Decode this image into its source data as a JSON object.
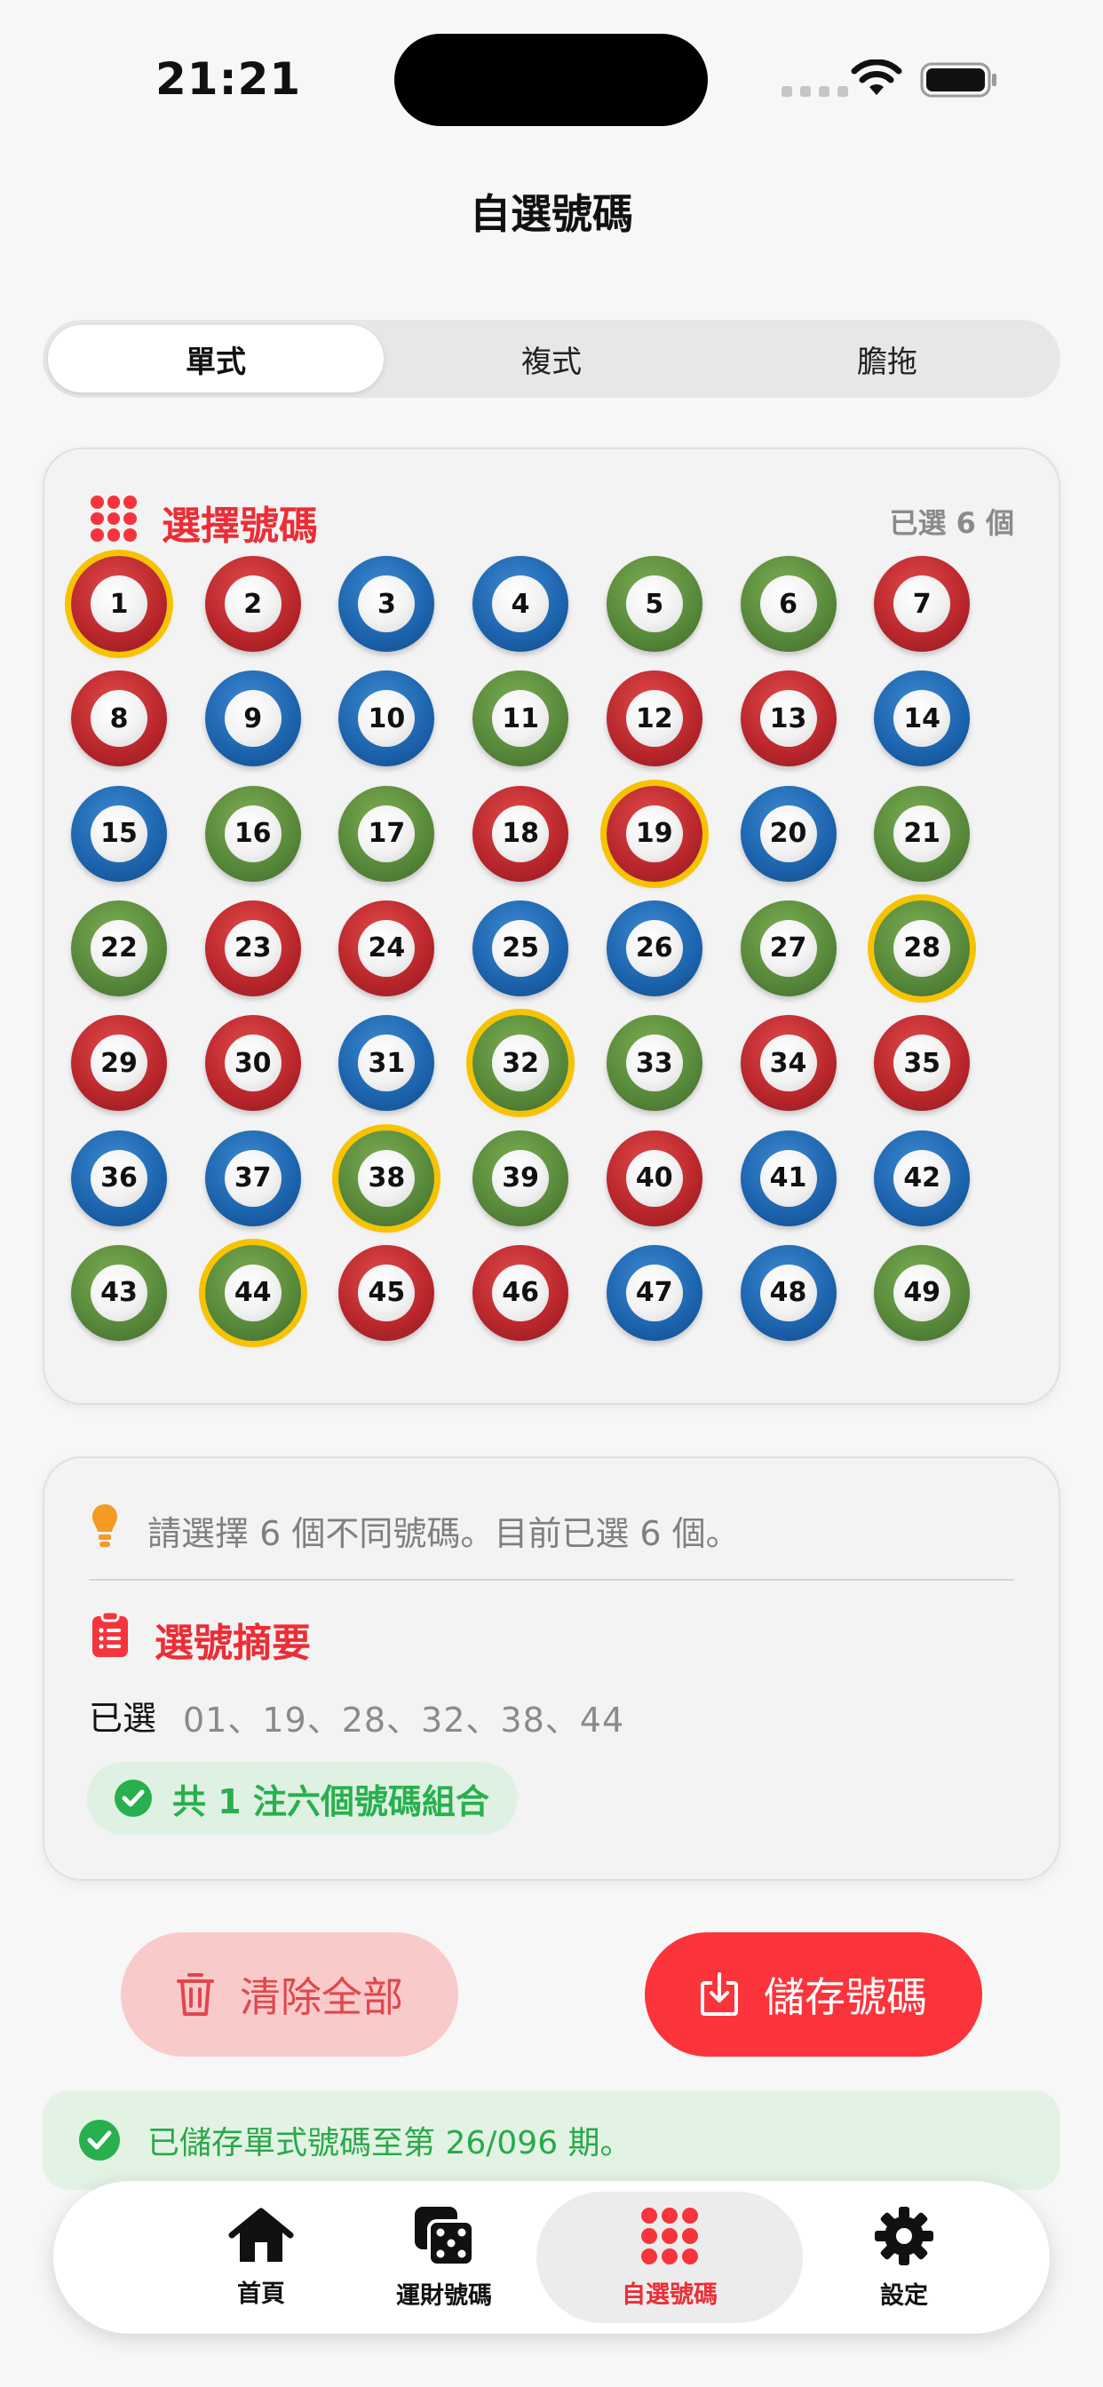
{
  "status_bar": {
    "time": "21:21"
  },
  "page": {
    "title": "自選號碼"
  },
  "segments": [
    {
      "label": "單式",
      "active": true
    },
    {
      "label": "複式",
      "active": false
    },
    {
      "label": "膽拖",
      "active": false
    }
  ],
  "picker": {
    "title": "選擇號碼",
    "count_text": "已選 6 個",
    "numbers": [
      {
        "n": "1",
        "color": "red",
        "selected": true
      },
      {
        "n": "2",
        "color": "red",
        "selected": false
      },
      {
        "n": "3",
        "color": "blue",
        "selected": false
      },
      {
        "n": "4",
        "color": "blue",
        "selected": false
      },
      {
        "n": "5",
        "color": "green",
        "selected": false
      },
      {
        "n": "6",
        "color": "green",
        "selected": false
      },
      {
        "n": "7",
        "color": "red",
        "selected": false
      },
      {
        "n": "8",
        "color": "red",
        "selected": false
      },
      {
        "n": "9",
        "color": "blue",
        "selected": false
      },
      {
        "n": "10",
        "color": "blue",
        "selected": false
      },
      {
        "n": "11",
        "color": "green",
        "selected": false
      },
      {
        "n": "12",
        "color": "red",
        "selected": false
      },
      {
        "n": "13",
        "color": "red",
        "selected": false
      },
      {
        "n": "14",
        "color": "blue",
        "selected": false
      },
      {
        "n": "15",
        "color": "blue",
        "selected": false
      },
      {
        "n": "16",
        "color": "green",
        "selected": false
      },
      {
        "n": "17",
        "color": "green",
        "selected": false
      },
      {
        "n": "18",
        "color": "red",
        "selected": false
      },
      {
        "n": "19",
        "color": "red",
        "selected": true
      },
      {
        "n": "20",
        "color": "blue",
        "selected": false
      },
      {
        "n": "21",
        "color": "green",
        "selected": false
      },
      {
        "n": "22",
        "color": "green",
        "selected": false
      },
      {
        "n": "23",
        "color": "red",
        "selected": false
      },
      {
        "n": "24",
        "color": "red",
        "selected": false
      },
      {
        "n": "25",
        "color": "blue",
        "selected": false
      },
      {
        "n": "26",
        "color": "blue",
        "selected": false
      },
      {
        "n": "27",
        "color": "green",
        "selected": false
      },
      {
        "n": "28",
        "color": "green",
        "selected": true
      },
      {
        "n": "29",
        "color": "red",
        "selected": false
      },
      {
        "n": "30",
        "color": "red",
        "selected": false
      },
      {
        "n": "31",
        "color": "blue",
        "selected": false
      },
      {
        "n": "32",
        "color": "green",
        "selected": true
      },
      {
        "n": "33",
        "color": "green",
        "selected": false
      },
      {
        "n": "34",
        "color": "red",
        "selected": false
      },
      {
        "n": "35",
        "color": "red",
        "selected": false
      },
      {
        "n": "36",
        "color": "blue",
        "selected": false
      },
      {
        "n": "37",
        "color": "blue",
        "selected": false
      },
      {
        "n": "38",
        "color": "green",
        "selected": true
      },
      {
        "n": "39",
        "color": "green",
        "selected": false
      },
      {
        "n": "40",
        "color": "red",
        "selected": false
      },
      {
        "n": "41",
        "color": "blue",
        "selected": false
      },
      {
        "n": "42",
        "color": "blue",
        "selected": false
      },
      {
        "n": "43",
        "color": "green",
        "selected": false
      },
      {
        "n": "44",
        "color": "green",
        "selected": true
      },
      {
        "n": "45",
        "color": "red",
        "selected": false
      },
      {
        "n": "46",
        "color": "red",
        "selected": false
      },
      {
        "n": "47",
        "color": "blue",
        "selected": false
      },
      {
        "n": "48",
        "color": "blue",
        "selected": false
      },
      {
        "n": "49",
        "color": "green",
        "selected": false
      }
    ]
  },
  "summary": {
    "hint": "請選擇 6 個不同號碼。目前已選 6 個。",
    "title": "選號摘要",
    "selected_label": "已選",
    "selected_numbers": "01、19、28、32、38、44",
    "combo_text": "共 1 注六個號碼組合"
  },
  "actions": {
    "clear_label": "清除全部",
    "save_label": "儲存號碼"
  },
  "toast": {
    "text": "已儲存單式號碼至第 26/096 期。"
  },
  "tab_bar": [
    {
      "label": "首頁",
      "icon": "home-icon",
      "active": false
    },
    {
      "label": "運財號碼",
      "icon": "dice-icon",
      "active": false
    },
    {
      "label": "自選號碼",
      "icon": "grid-dots-icon",
      "active": true
    },
    {
      "label": "設定",
      "icon": "gear-icon",
      "active": false
    }
  ],
  "colors": {
    "accent": "#ec2d36",
    "save_button": "#fb343b",
    "success": "#27b04d",
    "selected_ring": "#f7c300",
    "ball_red": "#b8262b",
    "ball_blue": "#1c63ad",
    "ball_green": "#57883a"
  }
}
